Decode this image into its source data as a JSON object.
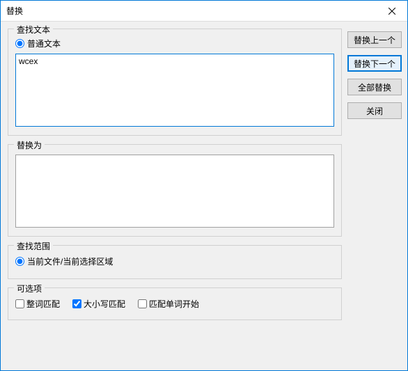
{
  "window": {
    "title": "替换"
  },
  "find": {
    "group_label": "查找文本",
    "radio_plain_label": "普通文本",
    "value": "wcex"
  },
  "replace": {
    "group_label": "替换为",
    "value": ""
  },
  "scope": {
    "group_label": "查找范围",
    "radio_current_label": "当前文件/当前选择区域"
  },
  "options": {
    "group_label": "可选项",
    "whole_word_label": "整词匹配",
    "case_label": "大小写匹配",
    "word_start_label": "匹配单词开始"
  },
  "buttons": {
    "replace_prev": "替换上一个",
    "replace_next": "替换下一个",
    "replace_all": "全部替换",
    "close": "关闭"
  }
}
